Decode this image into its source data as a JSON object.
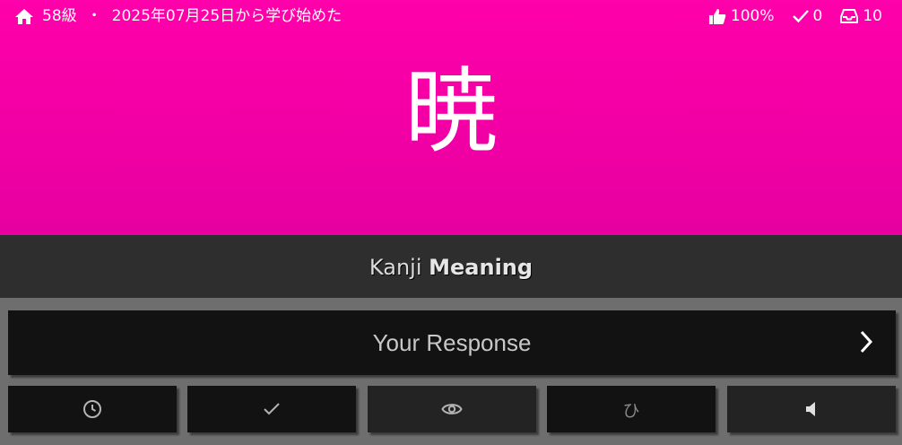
{
  "header": {
    "home_icon": "home-icon",
    "level": "58級",
    "separator": "・",
    "start_text": "2025年07月25日から学び始めた",
    "stats": {
      "accuracy": "100%",
      "correct": "0",
      "remaining": "10"
    },
    "background": "#ff00aa"
  },
  "card": {
    "kanji": "暁"
  },
  "prompt": {
    "type_label": "Kanji",
    "field_label": "Meaning"
  },
  "response": {
    "placeholder": "Your Response",
    "submit_icon": "chevron-right-icon"
  },
  "buttons": [
    {
      "icon": "clock-icon"
    },
    {
      "icon": "check-icon"
    },
    {
      "icon": "eye-icon"
    },
    {
      "label": "ひ"
    },
    {
      "icon": "speaker-icon"
    }
  ]
}
